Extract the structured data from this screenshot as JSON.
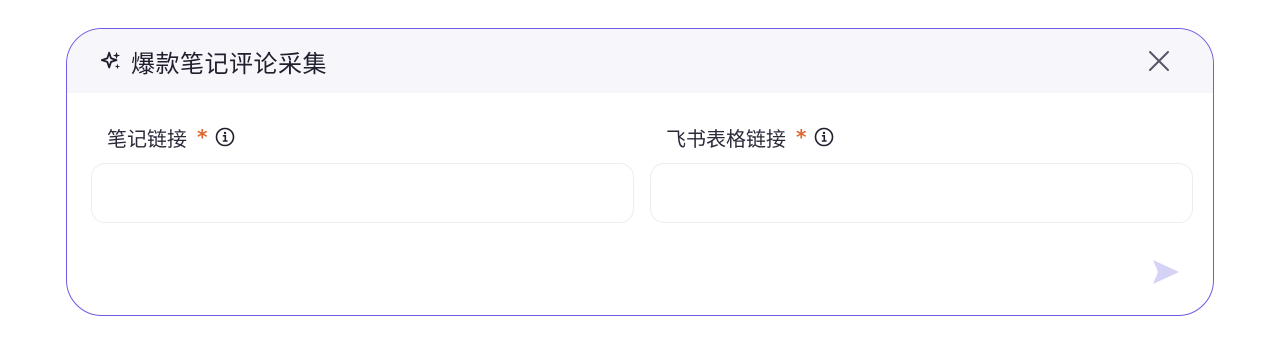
{
  "dialog": {
    "title": "爆款笔记评论采集",
    "title_icon": "sparkles-icon",
    "close_icon": "close-icon"
  },
  "fields": [
    {
      "label": "笔记链接",
      "required_mark": "*",
      "info_icon": "info-icon",
      "value": "",
      "placeholder": ""
    },
    {
      "label": "飞书表格链接",
      "required_mark": "*",
      "info_icon": "info-icon",
      "value": "",
      "placeholder": ""
    }
  ],
  "actions": {
    "send_icon": "send-icon"
  },
  "colors": {
    "accent": "#6c5ce7",
    "header_bg": "#f7f7fb",
    "required": "#e0672f",
    "send_disabled": "#d5d3f5",
    "input_border": "#ececf2"
  }
}
